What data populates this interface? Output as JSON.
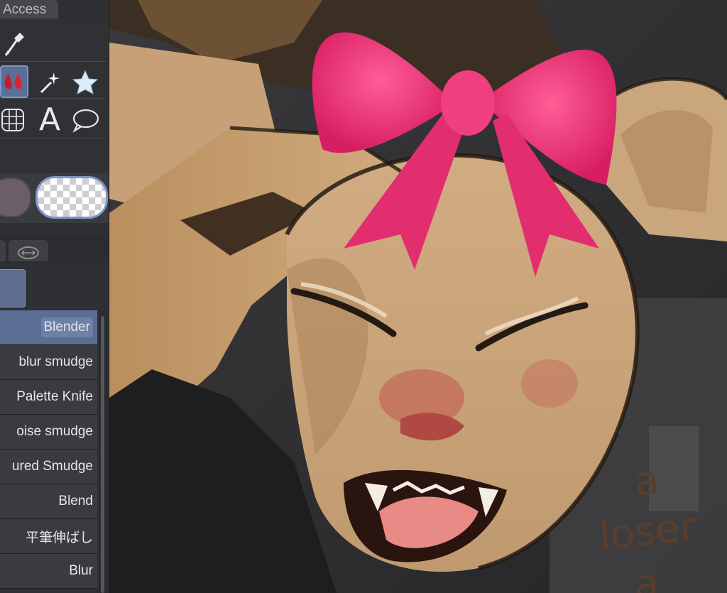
{
  "panel": {
    "access_tab": "Access",
    "tools_row1": [
      {
        "icon": "eyedropper-icon"
      }
    ],
    "tools_row2": [
      {
        "icon": "fill-drops-icon"
      },
      {
        "icon": "magic-wand-icon"
      },
      {
        "icon": "star-decoration-icon"
      }
    ],
    "tools_row3": [
      {
        "icon": "mesh-transform-icon"
      },
      {
        "icon": "text-tool-icon",
        "glyph": "A"
      },
      {
        "icon": "speech-balloon-icon"
      }
    ],
    "colors": {
      "main": "#6c5e68",
      "sub": "transparent",
      "selected_border": "#7d95c7"
    },
    "brush_list": [
      {
        "label": "Blender",
        "selected": true
      },
      {
        "label": "blur smudge"
      },
      {
        "label": "Palette Knife"
      },
      {
        "label": "oise smudge"
      },
      {
        "label": "ured Smudge"
      },
      {
        "label": "Blend"
      },
      {
        "label": "平筆伸ばし"
      },
      {
        "label": "Blur"
      }
    ]
  },
  "canvas": {
    "handwriting": [
      "a",
      "loser",
      "a"
    ],
    "colors": {
      "skin": "#c9a47a",
      "bow": "#ec3a7a",
      "background": "#2e2e30",
      "lineart": "#241a14"
    }
  }
}
